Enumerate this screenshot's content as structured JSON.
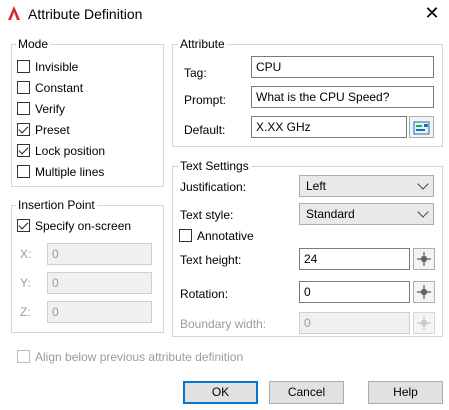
{
  "window": {
    "title": "Attribute Definition"
  },
  "mode": {
    "legend": "Mode",
    "items": [
      {
        "label": "Invisible",
        "checked": false
      },
      {
        "label": "Constant",
        "checked": false
      },
      {
        "label": "Verify",
        "checked": false
      },
      {
        "label": "Preset",
        "checked": true
      },
      {
        "label": "Lock position",
        "checked": true
      },
      {
        "label": "Multiple lines",
        "checked": false
      }
    ]
  },
  "attribute": {
    "legend": "Attribute",
    "tag_label": "Tag:",
    "tag_value": "CPU",
    "prompt_label": "Prompt:",
    "prompt_value": "What is the CPU Speed?",
    "default_label": "Default:",
    "default_value": "X.XX GHz",
    "insert_field_icon": "insert-field-icon"
  },
  "insertion_point": {
    "legend": "Insertion Point",
    "specify_on_screen_label": "Specify on-screen",
    "specify_on_screen_checked": true,
    "x_label": "X:",
    "x_value": "0",
    "y_label": "Y:",
    "y_value": "0",
    "z_label": "Z:",
    "z_value": "0"
  },
  "text_settings": {
    "legend": "Text Settings",
    "justification_label": "Justification:",
    "justification_value": "Left",
    "text_style_label": "Text style:",
    "text_style_value": "Standard",
    "annotative_label": "Annotative",
    "annotative_checked": false,
    "text_height_label": "Text height:",
    "text_height_value": "24",
    "rotation_label": "Rotation:",
    "rotation_value": "0",
    "boundary_width_label": "Boundary width:",
    "boundary_width_value": "0",
    "pick_icon": "crosshair-pick-icon"
  },
  "align_below": {
    "label": "Align below previous attribute definition",
    "checked": false
  },
  "buttons": {
    "ok": "OK",
    "cancel": "Cancel",
    "help": "Help"
  },
  "colors": {
    "accent": "#0078d7",
    "app_icon": "#d8262b"
  }
}
